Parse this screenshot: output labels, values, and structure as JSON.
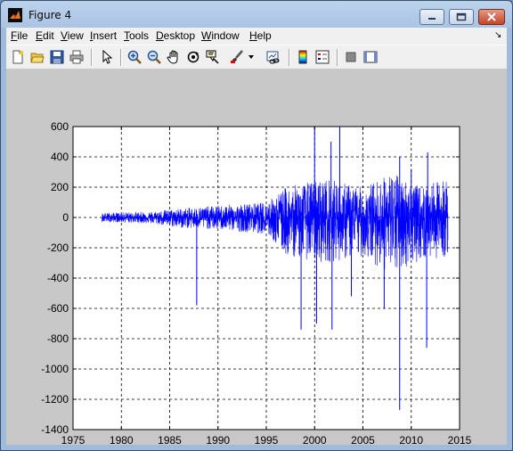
{
  "window": {
    "title": "Figure 4"
  },
  "menu": [
    {
      "u": "F",
      "rest": "ile"
    },
    {
      "u": "E",
      "rest": "dit"
    },
    {
      "u": "V",
      "rest": "iew"
    },
    {
      "u": "I",
      "rest": "nsert"
    },
    {
      "u": "T",
      "rest": "ools"
    },
    {
      "u": "D",
      "rest": "esktop"
    },
    {
      "u": "W",
      "rest": "indow"
    },
    {
      "u": "H",
      "rest": "elp"
    }
  ],
  "toolbar": {
    "icons": [
      "new-figure-icon",
      "open-file-icon",
      "save-icon",
      "print-icon",
      "select-arrow-icon",
      "zoom-in-icon",
      "zoom-out-icon",
      "pan-hand-icon",
      "rotate-3d-icon",
      "data-cursor-icon",
      "brush-icon",
      "brush-dropdown-icon",
      "link-plot-icon",
      "colorbar-icon",
      "legend-icon",
      "hide-plot-tools-icon",
      "show-plot-tools-icon"
    ]
  },
  "colors": {
    "line": "#0000ff",
    "figure_bg": "#c8c8c8",
    "axes_bg": "#ffffff"
  },
  "chart_data": {
    "type": "line",
    "title": "",
    "xlabel": "",
    "ylabel": "",
    "xlim": [
      1975,
      2015
    ],
    "ylim": [
      -1400,
      600
    ],
    "xticks": [
      1975,
      1980,
      1985,
      1990,
      1995,
      2000,
      2005,
      2010,
      2015
    ],
    "yticks": [
      600,
      400,
      200,
      0,
      -200,
      -400,
      -600,
      -800,
      -1000,
      -1200,
      -1400
    ],
    "grid": true,
    "grid_style": "dashed",
    "series": [
      {
        "color": "#0000ff",
        "x_start": 1978.0,
        "x_end": 2013.8,
        "envelope": [
          {
            "x": 1978,
            "hi": 30,
            "lo": -30
          },
          {
            "x": 1983,
            "hi": 40,
            "lo": -40
          },
          {
            "x": 1986,
            "hi": 60,
            "lo": -70
          },
          {
            "x": 1990,
            "hi": 80,
            "lo": -80
          },
          {
            "x": 1995,
            "hi": 100,
            "lo": -110
          },
          {
            "x": 1997,
            "hi": 200,
            "lo": -250
          },
          {
            "x": 2001,
            "hi": 260,
            "lo": -300
          },
          {
            "x": 2005,
            "hi": 200,
            "lo": -260
          },
          {
            "x": 2008,
            "hi": 300,
            "lo": -380
          },
          {
            "x": 2011,
            "hi": 200,
            "lo": -280
          },
          {
            "x": 2013.8,
            "hi": 260,
            "lo": -260
          }
        ],
        "spikes": [
          {
            "x": 1987.8,
            "y": -580
          },
          {
            "x": 1998.6,
            "y": -740
          },
          {
            "x": 2000.0,
            "y": 600
          },
          {
            "x": 2000.2,
            "y": -700
          },
          {
            "x": 2001.7,
            "y": 500
          },
          {
            "x": 2001.8,
            "y": -740
          },
          {
            "x": 2002.6,
            "y": 600
          },
          {
            "x": 2008.8,
            "y": 400
          },
          {
            "x": 2008.8,
            "y": -1270
          },
          {
            "x": 2010.0,
            "y": 320
          },
          {
            "x": 2011.7,
            "y": 430
          },
          {
            "x": 2011.6,
            "y": -860
          },
          {
            "x": 2007.2,
            "y": -600
          },
          {
            "x": 2003.8,
            "y": -520
          }
        ]
      }
    ]
  }
}
